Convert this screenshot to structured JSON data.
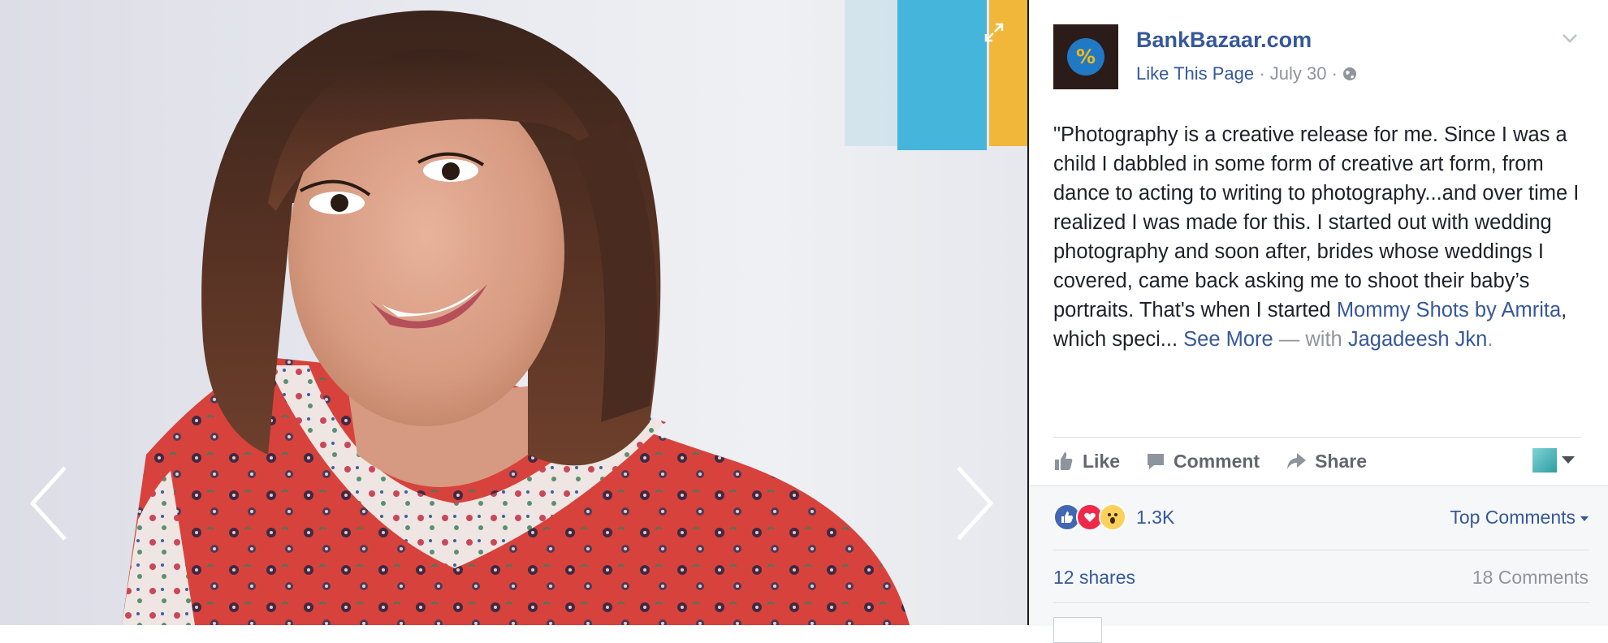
{
  "post": {
    "page_name": "BankBazaar.com",
    "like_page_label": "Like This Page",
    "separator": "·",
    "date": "July 30",
    "text_body": "\"Photography is a creative release for me. Since I was a child I dabbled in some form of creative art form, from dance to acting to writing to photography...and over time I realized I was made for this. I started out with wedding photography and soon after, brides whose weddings I covered, came back asking me to shoot their baby’s portraits. That's when I started ",
    "link_text": "Mommy Shots by Amrita",
    "text_after_link": ", which speci... ",
    "see_more": "See More",
    "with_prefix": " — with ",
    "tagged_person": "Jagadeesh Jkn",
    "end_period": "."
  },
  "actions": {
    "like": "Like",
    "comment": "Comment",
    "share": "Share"
  },
  "stats": {
    "reaction_count": "1.3K",
    "top_comments": "Top Comments",
    "shares": "12 shares",
    "comments": "18 Comments"
  },
  "colors": {
    "link": "#365899",
    "muted": "#90949c",
    "like_reaction": "#4267b2",
    "love_reaction": "#f0284a",
    "wow_reaction": "#fcd05b",
    "shirt_red": "#d8423c"
  },
  "icons": {
    "prev": "chevron-left-icon",
    "next": "chevron-right-icon",
    "expand": "expand-icon",
    "audience": "globe-icon",
    "menu": "chevron-down-icon",
    "like": "thumbs-up-icon",
    "comment": "speech-bubble-icon",
    "share": "share-arrow-icon"
  }
}
